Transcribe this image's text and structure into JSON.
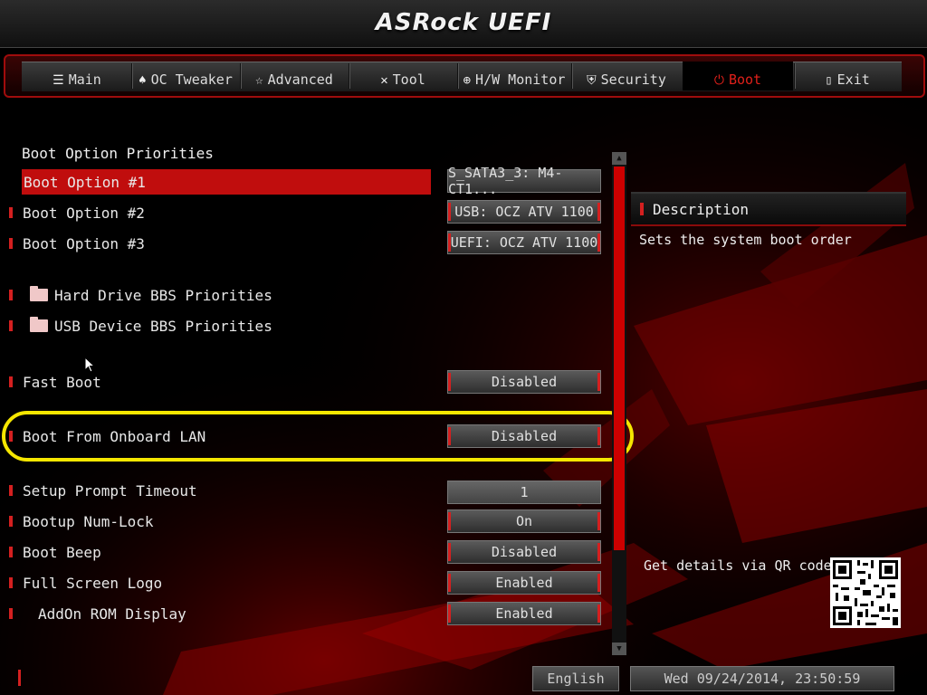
{
  "header": {
    "brand": "ASRock UEFI"
  },
  "nav": {
    "tabs": [
      {
        "label": "Main",
        "icon": "list-icon"
      },
      {
        "label": "OC Tweaker",
        "icon": "rocket-icon"
      },
      {
        "label": "Advanced",
        "icon": "star-icon"
      },
      {
        "label": "Tool",
        "icon": "tools-icon"
      },
      {
        "label": "H/W Monitor",
        "icon": "crosshair-icon"
      },
      {
        "label": "Security",
        "icon": "shield-icon"
      },
      {
        "label": "Boot",
        "icon": "power-icon",
        "active": true
      },
      {
        "label": "Exit",
        "icon": "exit-door-icon"
      }
    ]
  },
  "main": {
    "section_title": "Boot Option Priorities",
    "boot_options": [
      {
        "label": "Boot Option #1",
        "value": "S_SATA3_3: M4-CT1..."
      },
      {
        "label": "Boot Option #2",
        "value": "USB: OCZ ATV 1100"
      },
      {
        "label": "Boot Option #3",
        "value": "UEFI: OCZ ATV 1100"
      }
    ],
    "submenus": [
      {
        "label": "Hard Drive BBS Priorities"
      },
      {
        "label": "USB Device BBS Priorities"
      }
    ],
    "settings": [
      {
        "label": "Fast Boot",
        "value": "Disabled"
      },
      {
        "label": "Boot From Onboard LAN",
        "value": "Disabled"
      },
      {
        "label": "Setup Prompt Timeout",
        "value": "1"
      },
      {
        "label": "Bootup Num-Lock",
        "value": "On"
      },
      {
        "label": "Boot Beep",
        "value": "Disabled"
      },
      {
        "label": "Full Screen Logo",
        "value": "Enabled"
      },
      {
        "label": "AddOn ROM Display",
        "value": "Enabled"
      }
    ]
  },
  "description": {
    "title": "Description",
    "text": "Sets the system boot order",
    "qr_label": "Get details via QR code"
  },
  "footer": {
    "language": "English",
    "datetime": "Wed 09/24/2014, 23:50:59"
  },
  "colors": {
    "accent": "#c00d0d",
    "highlight": "#f5e600",
    "background": "#000000"
  }
}
